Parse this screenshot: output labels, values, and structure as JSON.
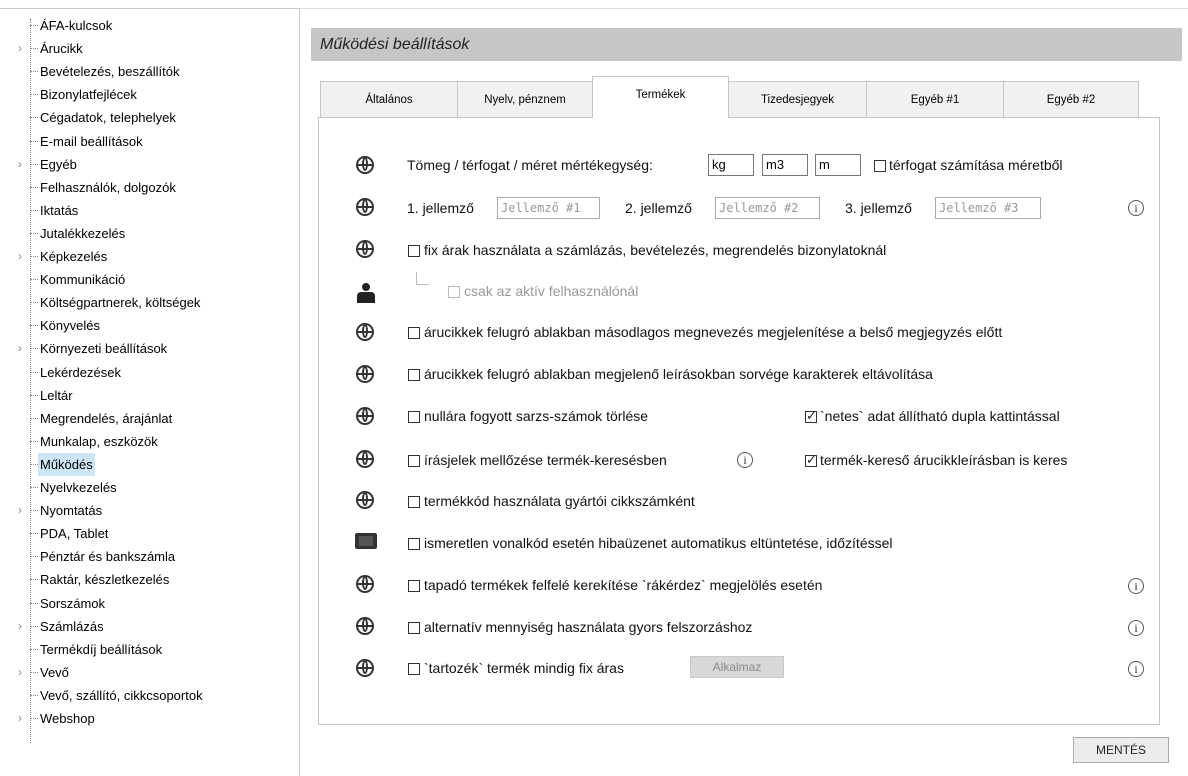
{
  "sidebar": {
    "items": [
      {
        "label": "ÁFA-kulcsok",
        "expandable": false
      },
      {
        "label": "Árucikk",
        "expandable": true
      },
      {
        "label": "Bevételezés, beszállítók",
        "expandable": false
      },
      {
        "label": "Bizonylatfejlécek",
        "expandable": false
      },
      {
        "label": "Cégadatok, telephelyek",
        "expandable": false
      },
      {
        "label": "E-mail beállítások",
        "expandable": false
      },
      {
        "label": "Egyéb",
        "expandable": true
      },
      {
        "label": "Felhasználók, dolgozók",
        "expandable": false
      },
      {
        "label": "Iktatás",
        "expandable": false
      },
      {
        "label": "Jutalékkezelés",
        "expandable": false
      },
      {
        "label": "Képkezelés",
        "expandable": true
      },
      {
        "label": "Kommunikáció",
        "expandable": false
      },
      {
        "label": "Költségpartnerek, költségek",
        "expandable": false
      },
      {
        "label": "Könyvelés",
        "expandable": false
      },
      {
        "label": "Környezeti beállítások",
        "expandable": true
      },
      {
        "label": "Lekérdezések",
        "expandable": false
      },
      {
        "label": "Leltár",
        "expandable": false
      },
      {
        "label": "Megrendelés, árajánlat",
        "expandable": false
      },
      {
        "label": "Munkalap, eszközök",
        "expandable": false
      },
      {
        "label": "Működés",
        "expandable": false,
        "selected": true
      },
      {
        "label": "Nyelvkezelés",
        "expandable": false
      },
      {
        "label": "Nyomtatás",
        "expandable": true
      },
      {
        "label": "PDA, Tablet",
        "expandable": false
      },
      {
        "label": "Pénztár és bankszámla",
        "expandable": false
      },
      {
        "label": "Raktár, készletkezelés",
        "expandable": false
      },
      {
        "label": "Sorszámok",
        "expandable": false
      },
      {
        "label": "Számlázás",
        "expandable": true
      },
      {
        "label": "Termékdíj beállítások",
        "expandable": false
      },
      {
        "label": "Vevő",
        "expandable": true
      },
      {
        "label": "Vevő, szállító, cikkcsoportok",
        "expandable": false
      },
      {
        "label": "Webshop",
        "expandable": true
      }
    ]
  },
  "header": {
    "title": "Működési beállítások"
  },
  "tabs": [
    {
      "label": "Általános"
    },
    {
      "label": "Nyelv, pénznem"
    },
    {
      "label": "Termékek",
      "active": true
    },
    {
      "label": "Tizedesjegyek"
    },
    {
      "label": "Egyéb #1"
    },
    {
      "label": "Egyéb #2"
    }
  ],
  "settings": {
    "units_label": "Tömeg / térfogat / méret mértékegység:",
    "unit_mass": "kg",
    "unit_volume": "m3",
    "unit_size": "m",
    "volume_calc_label": "térfogat számítása méretből",
    "attr1_label": "1. jellemző",
    "attr1_placeholder": "Jellemző #1",
    "attr2_label": "2. jellemző",
    "attr2_placeholder": "Jellemző #2",
    "attr3_label": "3. jellemző",
    "attr3_placeholder": "Jellemző #3",
    "fixed_prices_label": "fix árak használata a számlázás, bevételezés, megrendelés bizonylatoknál",
    "only_active_user_label": "csak az aktív felhasználónál",
    "secondary_name_label": "árucikkek felugró ablakban másodlagos megnevezés megjelenítése a belső megjegyzés előtt",
    "remove_eol_label": "árucikkek felugró ablakban megjelenő leírásokban sorvége karakterek eltávolítása",
    "delete_zero_batch_label": "nullára fogyott sarzs-számok törlése",
    "netes_label": "`netes` adat állítható dupla kattintással",
    "ignore_punct_label": "írásjelek mellőzése termék-keresésben",
    "search_desc_label": "termék-kereső árucikkleírásban is keres",
    "product_code_label": "termékkód használata gyártói cikkszámként",
    "barcode_error_label": "ismeretlen vonalkód esetén hibaüzenet automatikus eltüntetése, időzítéssel",
    "sticky_round_label": "tapadó termékek felfelé kerekítése `rákérdez` megjelölés esetén",
    "alt_qty_label": "alternatív mennyiség használata gyors felszorzáshoz",
    "accessory_label": "`tartozék` termék mindig fix áras",
    "apply_button": "Alkalmaz"
  },
  "info_glyph": "i",
  "save_button": "MENTÉS"
}
